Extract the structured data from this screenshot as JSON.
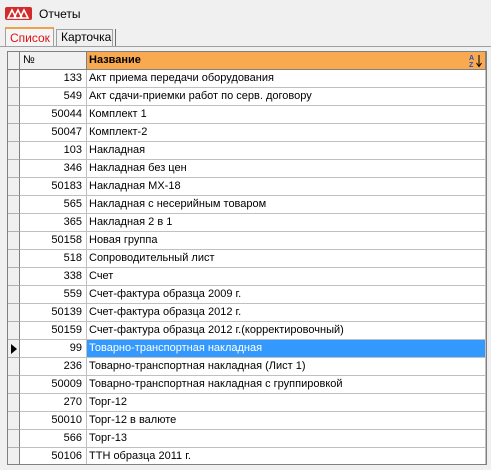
{
  "window": {
    "title": "Отчеты",
    "icon": "app-logo-icon",
    "accent_color": "#d32b2b"
  },
  "tabs": [
    {
      "label": "Список",
      "active": true
    },
    {
      "label": "Карточка",
      "active": false
    }
  ],
  "grid": {
    "columns": {
      "number": "№",
      "name": "Название"
    },
    "header_highlight_color": "#f9a94f",
    "sort_icon": "sort-az-icon",
    "selection_color": "#3399ff",
    "rows": [
      {
        "number": "133",
        "name": "Акт приема передачи оборудования"
      },
      {
        "number": "549",
        "name": "Акт сдачи-приемки работ по серв. договору"
      },
      {
        "number": "50044",
        "name": "Комплект 1"
      },
      {
        "number": "50047",
        "name": "Комплект-2"
      },
      {
        "number": "103",
        "name": "Накладная"
      },
      {
        "number": "346",
        "name": "Накладная без цен"
      },
      {
        "number": "50183",
        "name": "Накладная МХ-18"
      },
      {
        "number": "565",
        "name": "Накладная с несерийным товаром"
      },
      {
        "number": "365",
        "name": "Накладная 2 в 1"
      },
      {
        "number": "50158",
        "name": "Новая группа"
      },
      {
        "number": "518",
        "name": "Сопроводительный лист"
      },
      {
        "number": "338",
        "name": "Счет"
      },
      {
        "number": "559",
        "name": "Счет-фактура образца 2009 г."
      },
      {
        "number": "50139",
        "name": "Счет-фактура образца 2012 г."
      },
      {
        "number": "50159",
        "name": "Счет-фактура образца 2012 г.(корректировочный)"
      },
      {
        "number": "99",
        "name": "Товарно-транспортная накладная",
        "selected": true
      },
      {
        "number": "236",
        "name": "Товарно-транспортная накладная (Лист 1)"
      },
      {
        "number": "50009",
        "name": "Товарно-транспортная накладная с группировкой"
      },
      {
        "number": "270",
        "name": "Торг-12"
      },
      {
        "number": "50010",
        "name": "Торг-12 в валюте"
      },
      {
        "number": "566",
        "name": "Торг-13"
      },
      {
        "number": "50106",
        "name": "ТТН образца 2011 г."
      }
    ]
  }
}
